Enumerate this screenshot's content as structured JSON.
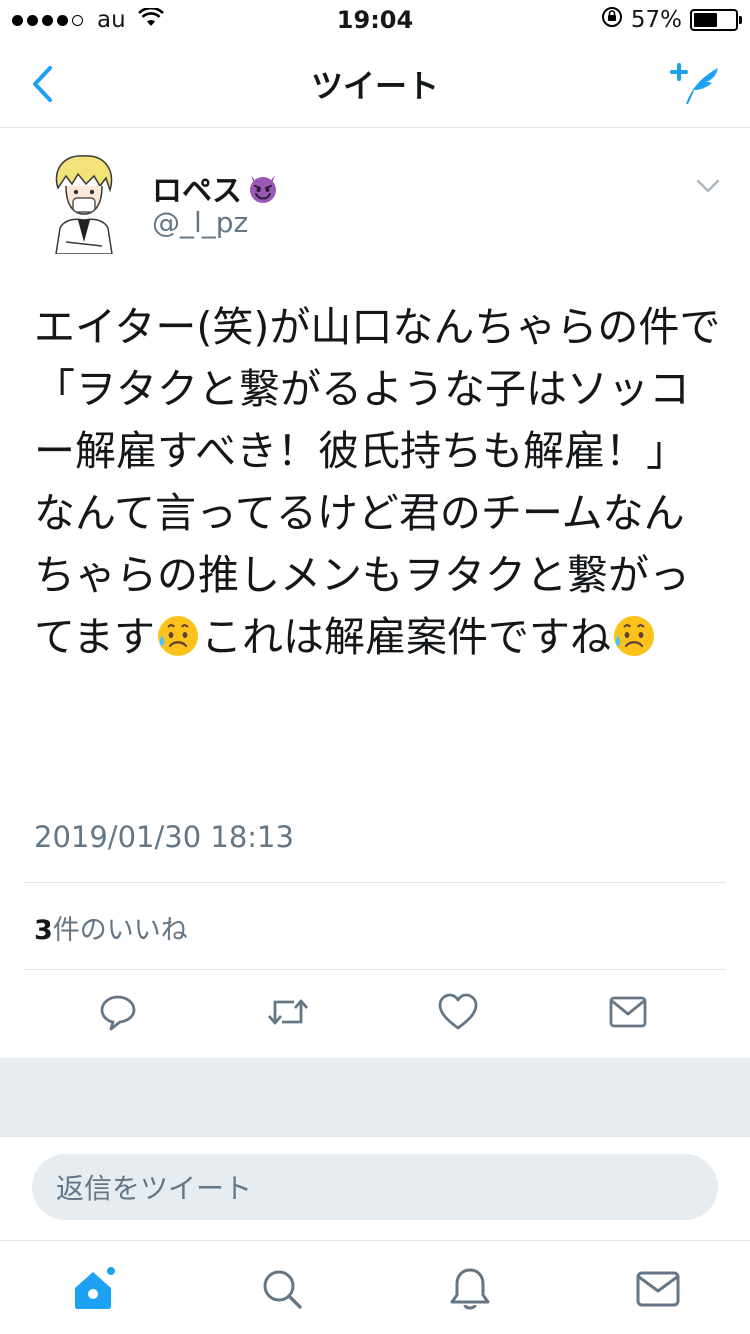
{
  "status_bar": {
    "carrier": "au",
    "time": "19:04",
    "battery_percent": "57%",
    "battery_level": 0.57,
    "signal_bars_filled": 4,
    "signal_bars_total": 5
  },
  "nav": {
    "title": "ツイート",
    "back_icon": "chevron-left-icon",
    "compose_icon": "compose-tweet-icon"
  },
  "tweet": {
    "display_name": "ロペス",
    "display_name_emoji": "smiling-devil-emoji",
    "username": "@_l_pz",
    "text_part1": "エイター(笑)が山口なんちゃらの件で\n「ヲタクと繋がるような子はソッコー解雇すべき！彼氏持ちも解雇！」なんて言ってるけど君のチームなんちゃらの推しメンもヲタクと繋がってます",
    "text_part2": "これは解雇案件ですね",
    "inline_emoji": "sad-relieved-face-emoji",
    "timestamp": "2019/01/30 18:13",
    "likes_count": "3",
    "likes_label": "件のいいね"
  },
  "actions": [
    "reply-icon",
    "retweet-icon",
    "like-icon",
    "share-icon"
  ],
  "reply": {
    "placeholder": "返信をツイート"
  },
  "tab_bar": [
    "home-icon",
    "search-icon",
    "notifications-icon",
    "messages-icon"
  ],
  "colors": {
    "accent": "#1da1f2",
    "text_secondary": "#657786",
    "divider": "#e1e8ed",
    "band": "#e6ecf0",
    "icon_gray": "#657786"
  }
}
